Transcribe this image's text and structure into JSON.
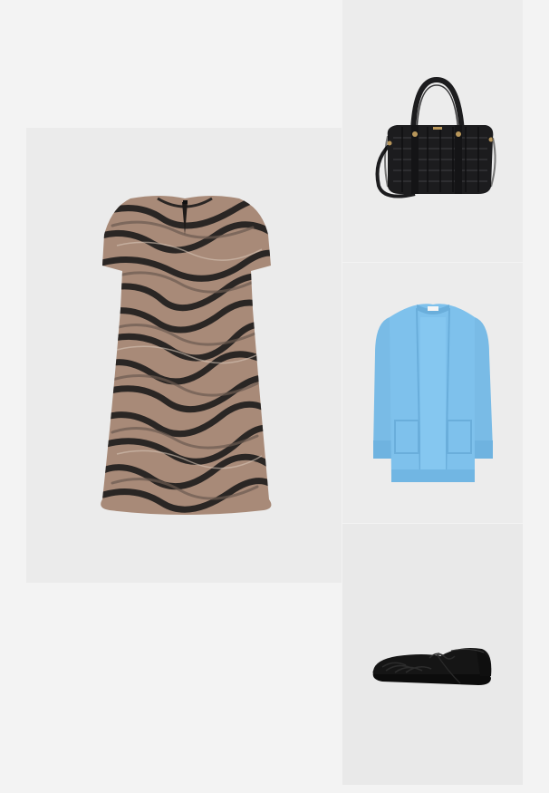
{
  "outfit": {
    "items": [
      {
        "name": "dress",
        "print": "zebra-jacquard",
        "colors": [
          "#a88a78",
          "#2a2624"
        ]
      },
      {
        "name": "bag",
        "colors": [
          "#1c1c1e",
          "#b8965a"
        ]
      },
      {
        "name": "cardigan",
        "colors": [
          "#7ec1ec"
        ]
      },
      {
        "name": "shoe",
        "colors": [
          "#151515"
        ]
      }
    ]
  },
  "theme": {
    "page_background": "#f3f3f3",
    "tile_background": "#ebebeb"
  }
}
